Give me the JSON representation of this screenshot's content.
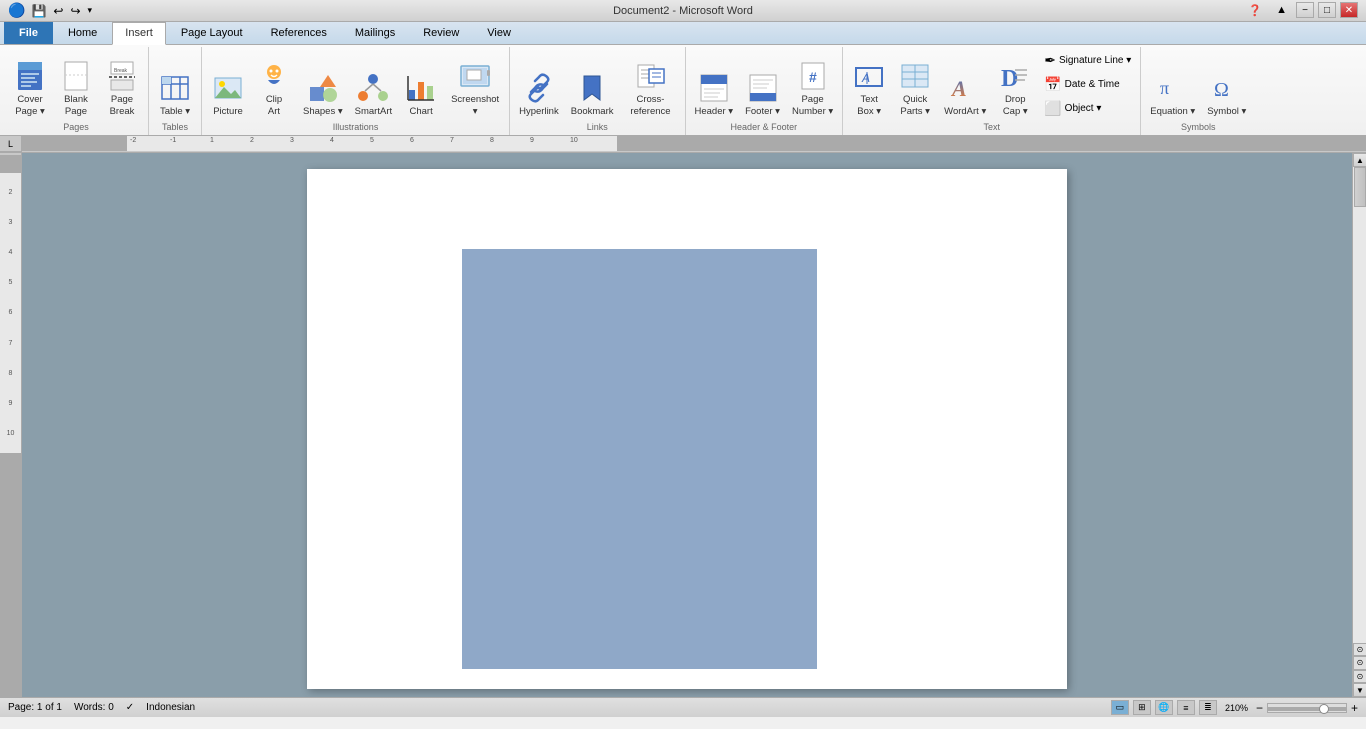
{
  "window": {
    "title": "Document2 - Microsoft Word",
    "minimize": "−",
    "maximize": "□",
    "close": "✕"
  },
  "quick_access": {
    "save": "💾",
    "undo": "↩",
    "redo": "↪",
    "customize": "▾"
  },
  "tabs": [
    "File",
    "Home",
    "Insert",
    "Page Layout",
    "References",
    "Mailings",
    "Review",
    "View"
  ],
  "active_tab": "Insert",
  "ribbon": {
    "groups": [
      {
        "name": "Pages",
        "buttons": [
          {
            "id": "cover-page",
            "label": "Cover\nPage",
            "icon": "cover"
          },
          {
            "id": "blank-page",
            "label": "Blank\nPage",
            "icon": "blank"
          },
          {
            "id": "page-break",
            "label": "Page\nBreak",
            "icon": "break"
          }
        ]
      },
      {
        "name": "Tables",
        "buttons": [
          {
            "id": "table",
            "label": "Table",
            "icon": "table"
          }
        ]
      },
      {
        "name": "Illustrations",
        "buttons": [
          {
            "id": "picture",
            "label": "Picture",
            "icon": "picture"
          },
          {
            "id": "clip-art",
            "label": "Clip\nArt",
            "icon": "clipart"
          },
          {
            "id": "shapes",
            "label": "Shapes",
            "icon": "shapes"
          },
          {
            "id": "smart-art",
            "label": "SmartArt",
            "icon": "smartart"
          },
          {
            "id": "chart",
            "label": "Chart",
            "icon": "chart"
          },
          {
            "id": "screenshot",
            "label": "Screenshot",
            "icon": "screenshot"
          }
        ]
      },
      {
        "name": "Links",
        "buttons": [
          {
            "id": "hyperlink",
            "label": "Hyperlink",
            "icon": "hyperlink"
          },
          {
            "id": "bookmark",
            "label": "Bookmark",
            "icon": "bookmark"
          },
          {
            "id": "cross-reference",
            "label": "Cross-reference",
            "icon": "crossref"
          }
        ]
      },
      {
        "name": "Header & Footer",
        "buttons": [
          {
            "id": "header",
            "label": "Header",
            "icon": "header"
          },
          {
            "id": "footer",
            "label": "Footer",
            "icon": "footer"
          },
          {
            "id": "page-number",
            "label": "Page\nNumber",
            "icon": "pagenumber"
          }
        ]
      },
      {
        "name": "Text",
        "buttons": [
          {
            "id": "text-box",
            "label": "Text\nBox",
            "icon": "textbox"
          },
          {
            "id": "quick-parts",
            "label": "Quick\nParts",
            "icon": "quickparts"
          },
          {
            "id": "wordart",
            "label": "WordArt",
            "icon": "wordart"
          },
          {
            "id": "drop-cap",
            "label": "Drop\nCap",
            "icon": "dropcap"
          },
          {
            "id": "signature-line",
            "label": "Signature Line",
            "icon": "signature",
            "size": "small"
          },
          {
            "id": "date-time",
            "label": "Date & Time",
            "icon": "datetime",
            "size": "small"
          },
          {
            "id": "object",
            "label": "Object",
            "icon": "object",
            "size": "small"
          }
        ]
      },
      {
        "name": "Symbols",
        "buttons": [
          {
            "id": "equation",
            "label": "Equation",
            "icon": "equation"
          },
          {
            "id": "symbol",
            "label": "Symbol",
            "icon": "symbol"
          }
        ]
      }
    ]
  },
  "status_bar": {
    "page": "Page: 1 of 1",
    "words": "Words: 0",
    "language": "Indonesian"
  },
  "zoom": "210%",
  "document": {
    "has_blue_box": true
  }
}
